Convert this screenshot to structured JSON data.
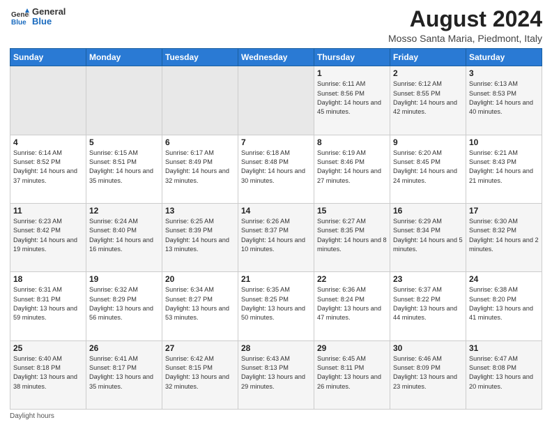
{
  "header": {
    "logo_general": "General",
    "logo_blue": "Blue",
    "month_year": "August 2024",
    "location": "Mosso Santa Maria, Piedmont, Italy"
  },
  "weekdays": [
    "Sunday",
    "Monday",
    "Tuesday",
    "Wednesday",
    "Thursday",
    "Friday",
    "Saturday"
  ],
  "weeks": [
    [
      {
        "day": "",
        "info": ""
      },
      {
        "day": "",
        "info": ""
      },
      {
        "day": "",
        "info": ""
      },
      {
        "day": "",
        "info": ""
      },
      {
        "day": "1",
        "info": "Sunrise: 6:11 AM\nSunset: 8:56 PM\nDaylight: 14 hours and 45 minutes."
      },
      {
        "day": "2",
        "info": "Sunrise: 6:12 AM\nSunset: 8:55 PM\nDaylight: 14 hours and 42 minutes."
      },
      {
        "day": "3",
        "info": "Sunrise: 6:13 AM\nSunset: 8:53 PM\nDaylight: 14 hours and 40 minutes."
      }
    ],
    [
      {
        "day": "4",
        "info": "Sunrise: 6:14 AM\nSunset: 8:52 PM\nDaylight: 14 hours and 37 minutes."
      },
      {
        "day": "5",
        "info": "Sunrise: 6:15 AM\nSunset: 8:51 PM\nDaylight: 14 hours and 35 minutes."
      },
      {
        "day": "6",
        "info": "Sunrise: 6:17 AM\nSunset: 8:49 PM\nDaylight: 14 hours and 32 minutes."
      },
      {
        "day": "7",
        "info": "Sunrise: 6:18 AM\nSunset: 8:48 PM\nDaylight: 14 hours and 30 minutes."
      },
      {
        "day": "8",
        "info": "Sunrise: 6:19 AM\nSunset: 8:46 PM\nDaylight: 14 hours and 27 minutes."
      },
      {
        "day": "9",
        "info": "Sunrise: 6:20 AM\nSunset: 8:45 PM\nDaylight: 14 hours and 24 minutes."
      },
      {
        "day": "10",
        "info": "Sunrise: 6:21 AM\nSunset: 8:43 PM\nDaylight: 14 hours and 21 minutes."
      }
    ],
    [
      {
        "day": "11",
        "info": "Sunrise: 6:23 AM\nSunset: 8:42 PM\nDaylight: 14 hours and 19 minutes."
      },
      {
        "day": "12",
        "info": "Sunrise: 6:24 AM\nSunset: 8:40 PM\nDaylight: 14 hours and 16 minutes."
      },
      {
        "day": "13",
        "info": "Sunrise: 6:25 AM\nSunset: 8:39 PM\nDaylight: 14 hours and 13 minutes."
      },
      {
        "day": "14",
        "info": "Sunrise: 6:26 AM\nSunset: 8:37 PM\nDaylight: 14 hours and 10 minutes."
      },
      {
        "day": "15",
        "info": "Sunrise: 6:27 AM\nSunset: 8:35 PM\nDaylight: 14 hours and 8 minutes."
      },
      {
        "day": "16",
        "info": "Sunrise: 6:29 AM\nSunset: 8:34 PM\nDaylight: 14 hours and 5 minutes."
      },
      {
        "day": "17",
        "info": "Sunrise: 6:30 AM\nSunset: 8:32 PM\nDaylight: 14 hours and 2 minutes."
      }
    ],
    [
      {
        "day": "18",
        "info": "Sunrise: 6:31 AM\nSunset: 8:31 PM\nDaylight: 13 hours and 59 minutes."
      },
      {
        "day": "19",
        "info": "Sunrise: 6:32 AM\nSunset: 8:29 PM\nDaylight: 13 hours and 56 minutes."
      },
      {
        "day": "20",
        "info": "Sunrise: 6:34 AM\nSunset: 8:27 PM\nDaylight: 13 hours and 53 minutes."
      },
      {
        "day": "21",
        "info": "Sunrise: 6:35 AM\nSunset: 8:25 PM\nDaylight: 13 hours and 50 minutes."
      },
      {
        "day": "22",
        "info": "Sunrise: 6:36 AM\nSunset: 8:24 PM\nDaylight: 13 hours and 47 minutes."
      },
      {
        "day": "23",
        "info": "Sunrise: 6:37 AM\nSunset: 8:22 PM\nDaylight: 13 hours and 44 minutes."
      },
      {
        "day": "24",
        "info": "Sunrise: 6:38 AM\nSunset: 8:20 PM\nDaylight: 13 hours and 41 minutes."
      }
    ],
    [
      {
        "day": "25",
        "info": "Sunrise: 6:40 AM\nSunset: 8:18 PM\nDaylight: 13 hours and 38 minutes."
      },
      {
        "day": "26",
        "info": "Sunrise: 6:41 AM\nSunset: 8:17 PM\nDaylight: 13 hours and 35 minutes."
      },
      {
        "day": "27",
        "info": "Sunrise: 6:42 AM\nSunset: 8:15 PM\nDaylight: 13 hours and 32 minutes."
      },
      {
        "day": "28",
        "info": "Sunrise: 6:43 AM\nSunset: 8:13 PM\nDaylight: 13 hours and 29 minutes."
      },
      {
        "day": "29",
        "info": "Sunrise: 6:45 AM\nSunset: 8:11 PM\nDaylight: 13 hours and 26 minutes."
      },
      {
        "day": "30",
        "info": "Sunrise: 6:46 AM\nSunset: 8:09 PM\nDaylight: 13 hours and 23 minutes."
      },
      {
        "day": "31",
        "info": "Sunrise: 6:47 AM\nSunset: 8:08 PM\nDaylight: 13 hours and 20 minutes."
      }
    ]
  ],
  "footer": {
    "daylight_label": "Daylight hours"
  }
}
